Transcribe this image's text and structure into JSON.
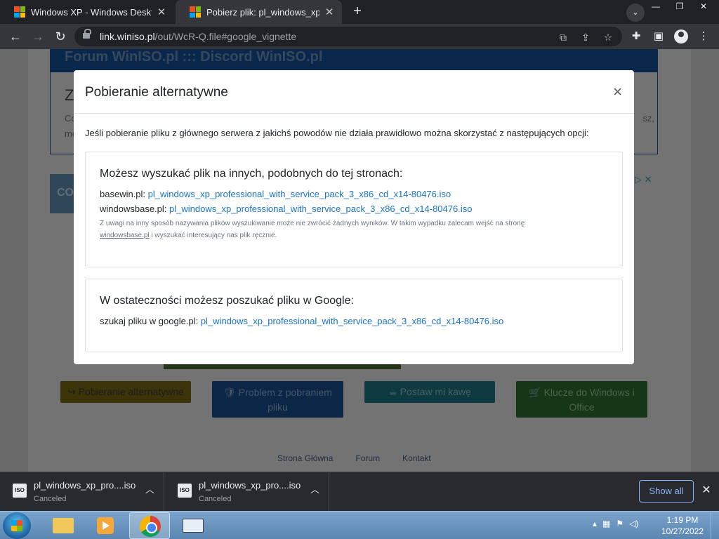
{
  "browser": {
    "tabs": [
      {
        "title": "Windows XP - Windows Desktop",
        "active": false
      },
      {
        "title": "Pobierz plik: pl_windows_xp_prof",
        "active": true
      }
    ],
    "new_tab": "+",
    "url_domain": "link.winiso.pl",
    "url_path": "/out/WcR-Q.file#google_vignette",
    "window_controls": [
      "—",
      "❐",
      "✕"
    ]
  },
  "page_bg": {
    "header": "Forum WinISO.pl ::: Discord WinISO.pl",
    "z_heading": "Z",
    "co_text": "Co",
    "me_text": "me",
    "sz_text": "sz,",
    "ad_text": "CO",
    "buttons": [
      "↪ Pobieranie alternatywne",
      "🛡 Problem z pobraniem pliku",
      "☕ Postaw mi kawę",
      "🛒 Klucze do Windows i Office"
    ],
    "footer_links": [
      "Strona Główna",
      "Forum",
      "Kontakt"
    ]
  },
  "modal": {
    "title": "Pobieranie alternatywne",
    "close": "×",
    "intro": "Jeśli pobieranie pliku z głównego serwera z jakichś powodów nie działa prawidłowo można skorzystać z następujących opcji:",
    "box1": {
      "heading": "Możesz wyszukać plik na innych, podobnych do tej stronach:",
      "rows": [
        {
          "label": "basewin.pl:",
          "link": "pl_windows_xp_professional_with_service_pack_3_x86_cd_x14-80476.iso"
        },
        {
          "label": "windowsbase.pl:",
          "link": "pl_windows_xp_professional_with_service_pack_3_x86_cd_x14-80476.iso"
        }
      ],
      "note_a": "Z uwagi na inny sposób nazywania plików wyszukiwanie może nie zwrócić żadnych wyników. W takim wypadku zalecam wejść na stronę",
      "note_link": "windowsbase.pl",
      "note_b": "i wyszukać interesujący nas plik ręcznie."
    },
    "box2": {
      "heading": "W ostateczności możesz poszukać pliku w Google:",
      "label": "szukaj pliku w google.pl:",
      "link": "pl_windows_xp_professional_with_service_pack_3_x86_cd_x14-80476.iso"
    }
  },
  "downloads": {
    "items": [
      {
        "name": "pl_windows_xp_pro....iso",
        "status": "Canceled",
        "icon": "ISO"
      },
      {
        "name": "pl_windows_xp_pro....iso",
        "status": "Canceled",
        "icon": "ISO"
      }
    ],
    "show_all": "Show all"
  },
  "taskbar": {
    "time": "1:19 PM",
    "date": "10/27/2022"
  }
}
